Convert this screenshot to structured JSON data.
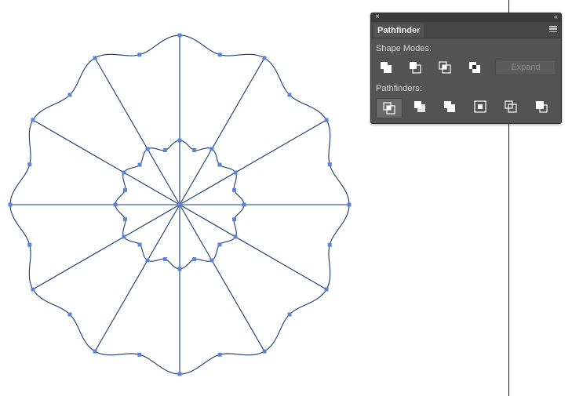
{
  "canvas": {
    "artwork": "flower-shaped compound path with radial spokes and blue anchor points",
    "path_color": "#1a3a6b",
    "anchor_color": "#5b86d6"
  },
  "panel": {
    "close_glyph": "×",
    "collapse_glyph": "‹‹",
    "tab_label": "Pathfinder",
    "shape_modes_label": "Shape Modes:",
    "expand_label": "Expand",
    "pathfinders_label": "Pathfinders:",
    "shape_mode_icons": [
      "unite-icon",
      "minus-front-icon",
      "intersect-icon",
      "exclude-icon"
    ],
    "pathfinder_icons": [
      "divide-icon",
      "trim-icon",
      "merge-icon",
      "crop-icon",
      "outline-icon",
      "minus-back-icon"
    ],
    "colors": {
      "panel_bg": "#535353",
      "titlebar_bg": "#3b3b3b",
      "icon_light": "#ffffff",
      "icon_dark": "#2b2b2b"
    }
  }
}
